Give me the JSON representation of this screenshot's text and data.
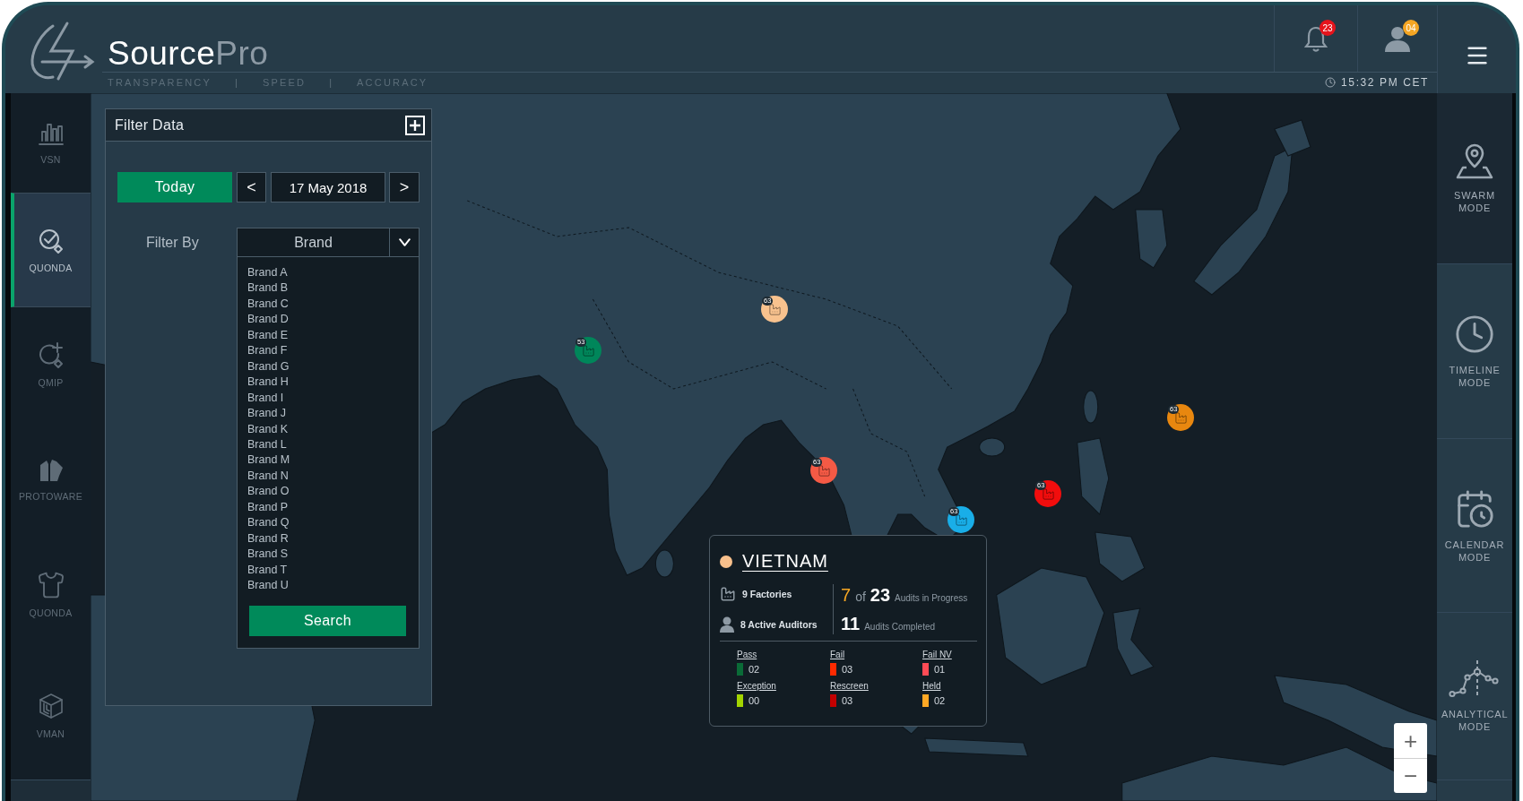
{
  "header": {
    "logo": {
      "name": "Source",
      "suffix": "Pro"
    },
    "tagline": {
      "words": [
        "TRANSPARENCY",
        "SPEED",
        "ACCURACY"
      ],
      "separators": [
        "|",
        "|"
      ]
    },
    "notifications": {
      "count": "23"
    },
    "profile": {
      "count": "04"
    },
    "time": "15:32 PM CET"
  },
  "left_sidebar": {
    "items": [
      {
        "label": "VSN",
        "selected": false
      },
      {
        "label": "QUONDA",
        "selected": true
      },
      {
        "label": "QMIP",
        "selected": false
      },
      {
        "label": "PROTOWARE",
        "selected": false
      },
      {
        "label": "QUONDA",
        "selected": false
      },
      {
        "label": "VMAN",
        "selected": false
      }
    ]
  },
  "filter_panel": {
    "title": "Filter Data",
    "today": "Today",
    "prev": "<",
    "date": "17 May 2018",
    "next": ">",
    "filter_by": "Filter By",
    "dropdown": "Brand",
    "brands": [
      "Brand A",
      "Brand B",
      "Brand C",
      "Brand D",
      "Brand E",
      "Brand F",
      "Brand G",
      "Brand H",
      "Brand I",
      "Brand J",
      "Brand K",
      "Brand L",
      "Brand M",
      "Brand N",
      "Brand O",
      "Brand P",
      "Brand Q",
      "Brand R",
      "Brand S",
      "Brand T",
      "Brand U"
    ],
    "search": "Search"
  },
  "map": {
    "markers": [
      {
        "count": "63",
        "color": "#f8c28e"
      },
      {
        "count": "53",
        "color": "#00865a"
      },
      {
        "count": "63",
        "color": "#f55a45"
      },
      {
        "count": "63",
        "color": "#e8870f"
      },
      {
        "count": "63",
        "color": "#f20d0d"
      },
      {
        "count": "63",
        "color": "#19aee8"
      }
    ],
    "zoom_in": "+",
    "zoom_out": "−"
  },
  "popup": {
    "title": "VIETNAM",
    "color": "#f8c08c",
    "factories": "9 Factories",
    "auditors": "8 Active Auditors",
    "in_progress": {
      "count": "7",
      "of": "of",
      "total": "23",
      "label": "Audits in Progress"
    },
    "completed": {
      "count": "11",
      "label": "Audits Completed"
    },
    "statuses": [
      {
        "label": "Pass",
        "value": "02",
        "color": "#0a6b37"
      },
      {
        "label": "Fail",
        "value": "03",
        "color": "#ff2a00"
      },
      {
        "label": "Fail NV",
        "value": "01",
        "color": "#ff4b55"
      },
      {
        "label": "Exception",
        "value": "00",
        "color": "#a3d400"
      },
      {
        "label": "Rescreen",
        "value": "03",
        "color": "#c30000"
      },
      {
        "label": "Held",
        "value": "02",
        "color": "#ffa825"
      }
    ]
  },
  "right_sidebar": {
    "items": [
      {
        "label": "SWARM MODE",
        "selected": true
      },
      {
        "label": "TIMELINE MODE",
        "selected": false
      },
      {
        "label": "CALENDAR MODE",
        "selected": false
      },
      {
        "label": "ANALYTICAL MODE",
        "selected": false
      }
    ]
  }
}
